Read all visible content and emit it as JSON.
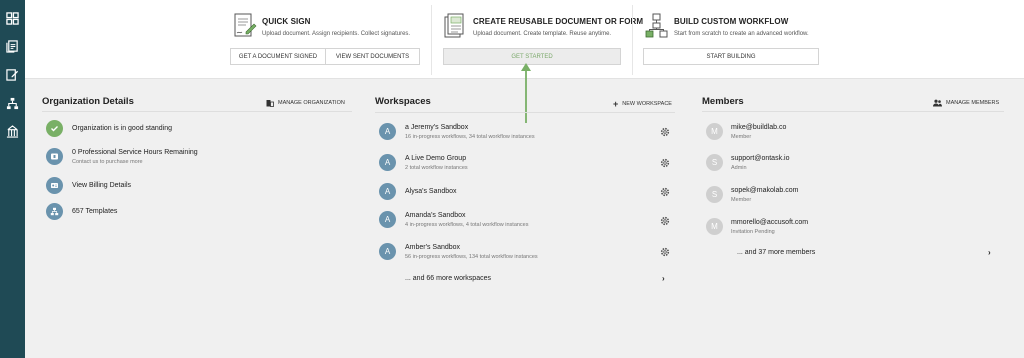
{
  "sidebar": {
    "items": [
      {
        "icon": "dashboard-icon"
      },
      {
        "icon": "documents-icon"
      },
      {
        "icon": "sign-icon"
      },
      {
        "icon": "workflow-icon"
      },
      {
        "icon": "organization-icon"
      }
    ]
  },
  "quick_actions": [
    {
      "title": "QUICK SIGN",
      "description": "Upload document. Assign recipients. Collect signatures.",
      "buttons": [
        "GET A DOCUMENT SIGNED",
        "VIEW SENT DOCUMENTS"
      ]
    },
    {
      "title": "CREATE REUSABLE DOCUMENT OR FORM",
      "description": "Upload document. Create template. Reuse anytime.",
      "buttons": [
        "GET STARTED"
      ]
    },
    {
      "title": "BUILD CUSTOM WORKFLOW",
      "description": "Start from scratch to create an advanced workflow.",
      "buttons": [
        "START BUILDING"
      ]
    }
  ],
  "organization": {
    "title": "Organization Details",
    "manage_label": "MANAGE ORGANIZATION",
    "items": [
      {
        "label": "Organization is in good standing",
        "sub": ""
      },
      {
        "label": "0 Professional Service Hours Remaining",
        "sub": "Contact us to purchase more"
      },
      {
        "label": "View Billing Details",
        "sub": ""
      },
      {
        "label": "657 Templates",
        "sub": ""
      }
    ]
  },
  "workspaces": {
    "title": "Workspaces",
    "new_label": "NEW WORKSPACE",
    "items": [
      {
        "initial": "A",
        "name": "a Jeremy's Sandbox",
        "detail": "16 in-progress workflows, 34 total workflow instances"
      },
      {
        "initial": "A",
        "name": "A Live Demo Group",
        "detail": "2 total workflow instances"
      },
      {
        "initial": "A",
        "name": "Alysa's Sandbox",
        "detail": ""
      },
      {
        "initial": "A",
        "name": "Amanda's Sandbox",
        "detail": "4 in-progress workflows, 4 total workflow instances"
      },
      {
        "initial": "A",
        "name": "Amber's Sandbox",
        "detail": "56 in-progress workflows, 134 total workflow instances"
      }
    ],
    "more_label": "... and 66 more workspaces"
  },
  "members": {
    "title": "Members",
    "manage_label": "MANAGE MEMBERS",
    "items": [
      {
        "initial": "M",
        "email": "mike@buildlab.co",
        "role": "Member"
      },
      {
        "initial": "S",
        "email": "support@ontask.io",
        "role": "Admin"
      },
      {
        "initial": "S",
        "email": "sopek@makolab.com",
        "role": "Member"
      },
      {
        "initial": "M",
        "email": "mmorello@accusoft.com",
        "role": "Invitation Pending"
      }
    ],
    "more_label": "... and 37 more members"
  },
  "colors": {
    "sidebar": "#1f4a55",
    "success": "#79b066",
    "avatar_blue": "#6a93ad",
    "avatar_gray": "#cfcfcf",
    "highlight_arrow": "#79b066"
  }
}
